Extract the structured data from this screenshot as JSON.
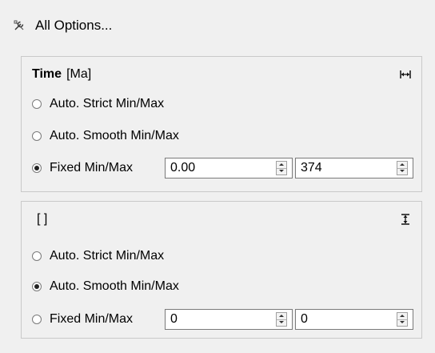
{
  "header": {
    "all_options_label": "All Options...",
    "all_options_icon": "wrench-screwdriver-icon"
  },
  "groups": [
    {
      "title_name": "Time",
      "title_unit": "[Ma]",
      "axis_icon": "horizontal-fit-icon",
      "options": {
        "strict": "Auto. Strict Min/Max",
        "smooth": "Auto. Smooth Min/Max",
        "fixed": "Fixed Min/Max"
      },
      "selected": "fixed",
      "min_value": "0.00",
      "max_value": "374"
    },
    {
      "title_name": "",
      "title_unit": "[ ]",
      "axis_icon": "vertical-fit-icon",
      "options": {
        "strict": "Auto. Strict Min/Max",
        "smooth": "Auto. Smooth Min/Max",
        "fixed": "Fixed Min/Max"
      },
      "selected": "smooth",
      "min_value": "0",
      "max_value": "0"
    }
  ]
}
